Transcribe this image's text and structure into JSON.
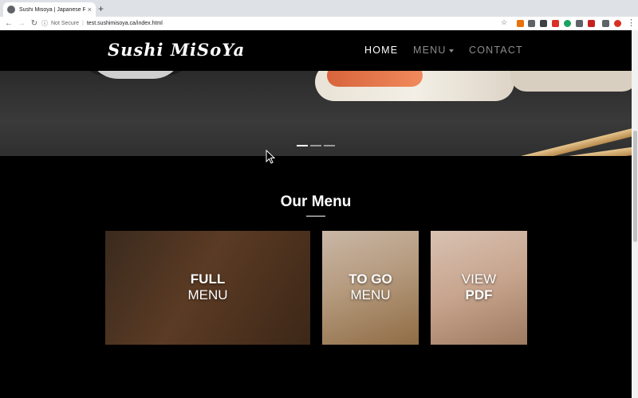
{
  "browser": {
    "tab_title": "Sushi Misoya | Japanese Resta",
    "tab_close": "×",
    "new_tab": "+",
    "security_label": "Not Secure",
    "url": "test.sushimisoya.ca/index.html"
  },
  "site": {
    "logo": "Sushi MiSoYa",
    "nav": {
      "home": "HOME",
      "menu": "MENU",
      "contact": "CONTACT"
    }
  },
  "section": {
    "title": "Our Menu"
  },
  "cards": [
    {
      "line1": "FULL",
      "line2": "MENU"
    },
    {
      "line1": "TO GO",
      "line2": "MENU"
    },
    {
      "line1": "VIEW",
      "line2": "PDF"
    }
  ],
  "colors": {
    "page_bg": "#000000",
    "nav_active": "#ffffff",
    "nav_inactive": "#8c8c8c"
  }
}
